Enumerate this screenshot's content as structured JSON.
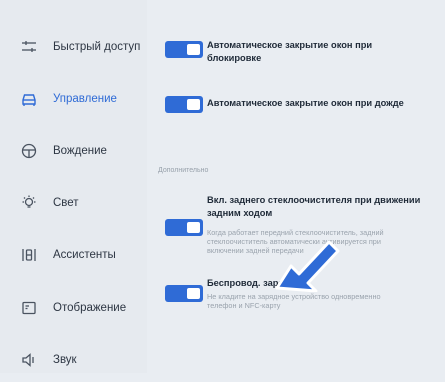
{
  "sidebar": {
    "items": [
      {
        "label": "Быстрый доступ",
        "icon": "sliders-icon",
        "active": false
      },
      {
        "label": "Управление",
        "icon": "car-icon",
        "active": true
      },
      {
        "label": "Вождение",
        "icon": "steering-wheel-icon",
        "active": false
      },
      {
        "label": "Свет",
        "icon": "light-bulb-icon",
        "active": false
      },
      {
        "label": "Ассистенты",
        "icon": "assistants-icon",
        "active": false
      },
      {
        "label": "Отображение",
        "icon": "display-icon",
        "active": false
      },
      {
        "label": "Звук",
        "icon": "speaker-icon",
        "active": false
      }
    ]
  },
  "settings": {
    "auto_close_lock": {
      "title_line1": "Автоматическое закрытие окон при",
      "title_line2": "блокировке",
      "enabled": true
    },
    "auto_close_rain": {
      "title": "Автоматическое закрытие окон при дожде",
      "enabled": true
    },
    "section_label": "Дополнительно",
    "rear_wiper": {
      "title_line1": "Вкл. заднего стеклоочистителя при движении",
      "title_line2": "задним ходом",
      "desc_line1": "Когда работает передний стеклоочиститель, задний",
      "desc_line2": "стеклоочиститель автоматически активируется при",
      "desc_line3": "включении задней передачи",
      "enabled": true
    },
    "wireless_charging": {
      "title": "Беспровод. зарядка",
      "desc_line1": "Не кладите на зарядное устройство одновременно",
      "desc_line2": "телефон и NFC-карту",
      "enabled": true
    }
  },
  "colors": {
    "accent": "#2f6bd6",
    "arrow": "#2f6bd6",
    "background": "#e9edf2"
  }
}
